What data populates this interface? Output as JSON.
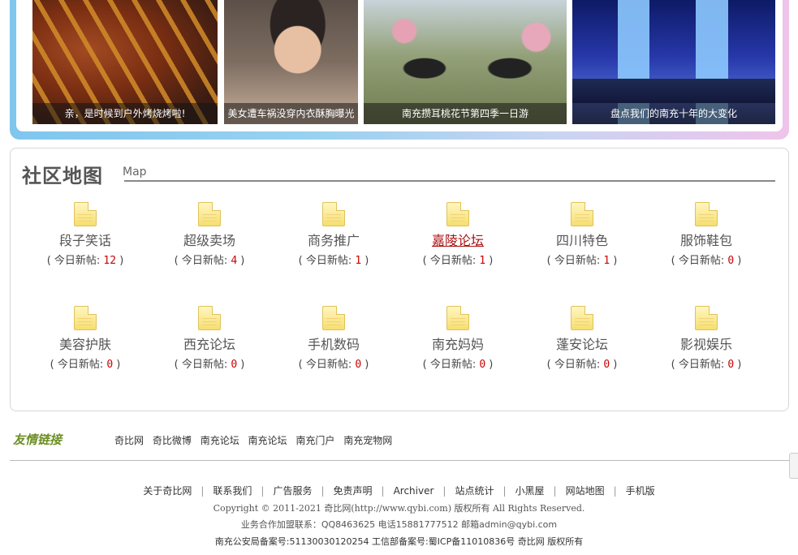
{
  "photos": [
    {
      "caption": "亲，是时候到户外烤烧烤啦!"
    },
    {
      "caption": "美女遭车祸没穿内衣酥胸曝光"
    },
    {
      "caption": "南充攒耳桃花节第四季一日游"
    },
    {
      "caption": "盘点我们的南充十年的大变化"
    }
  ],
  "map": {
    "title": "社区地图",
    "subtitle": "Map"
  },
  "forums": [
    {
      "name": "段子笑话",
      "prefix": "( 今日新帖: ",
      "count": "12",
      "suffix": " )"
    },
    {
      "name": "超级卖场",
      "prefix": "( 今日新帖: ",
      "count": "4",
      "suffix": " )"
    },
    {
      "name": "商务推广",
      "prefix": "( 今日新帖: ",
      "count": "1",
      "suffix": " )"
    },
    {
      "name": "嘉陵论坛",
      "prefix": "( 今日新帖: ",
      "count": "1",
      "suffix": " )"
    },
    {
      "name": "四川特色",
      "prefix": "( 今日新帖: ",
      "count": "1",
      "suffix": " )"
    },
    {
      "name": "服饰鞋包",
      "prefix": "( 今日新帖: ",
      "count": "0",
      "suffix": " )"
    },
    {
      "name": "美容护肤",
      "prefix": "( 今日新帖: ",
      "count": "0",
      "suffix": " )"
    },
    {
      "name": "西充论坛",
      "prefix": "( 今日新帖: ",
      "count": "0",
      "suffix": " )"
    },
    {
      "name": "手机数码",
      "prefix": "( 今日新帖: ",
      "count": "0",
      "suffix": " )"
    },
    {
      "name": "南充妈妈",
      "prefix": "( 今日新帖: ",
      "count": "0",
      "suffix": " )"
    },
    {
      "name": "蓬安论坛",
      "prefix": "( 今日新帖: ",
      "count": "0",
      "suffix": " )"
    },
    {
      "name": "影视娱乐",
      "prefix": "( 今日新帖: ",
      "count": "0",
      "suffix": " )"
    }
  ],
  "friend_links": {
    "label": "友情链接",
    "items": [
      "奇比网",
      "奇比微博",
      "南充论坛",
      "南充论坛",
      "南充门户",
      "南充宠物网"
    ]
  },
  "footer": {
    "nav": [
      "关于奇比网",
      "联系我们",
      "广告服务",
      "免责声明",
      "Archiver",
      "站点统计",
      "小黑屋",
      "网站地图",
      "手机版"
    ],
    "separator": "|",
    "copyright": "Copyright © 2011-2021 奇比网(http://www.qybi.com) 版权所有 All Rights Reserved.",
    "contact": "业务合作加盟联系：QQ8463625 电话15881777512 邮箱admin@qybi.com",
    "beian": "南充公安局备案号:51130030120254 工信部备案号:蜀ICP备11010836号 奇比网 版权所有"
  }
}
